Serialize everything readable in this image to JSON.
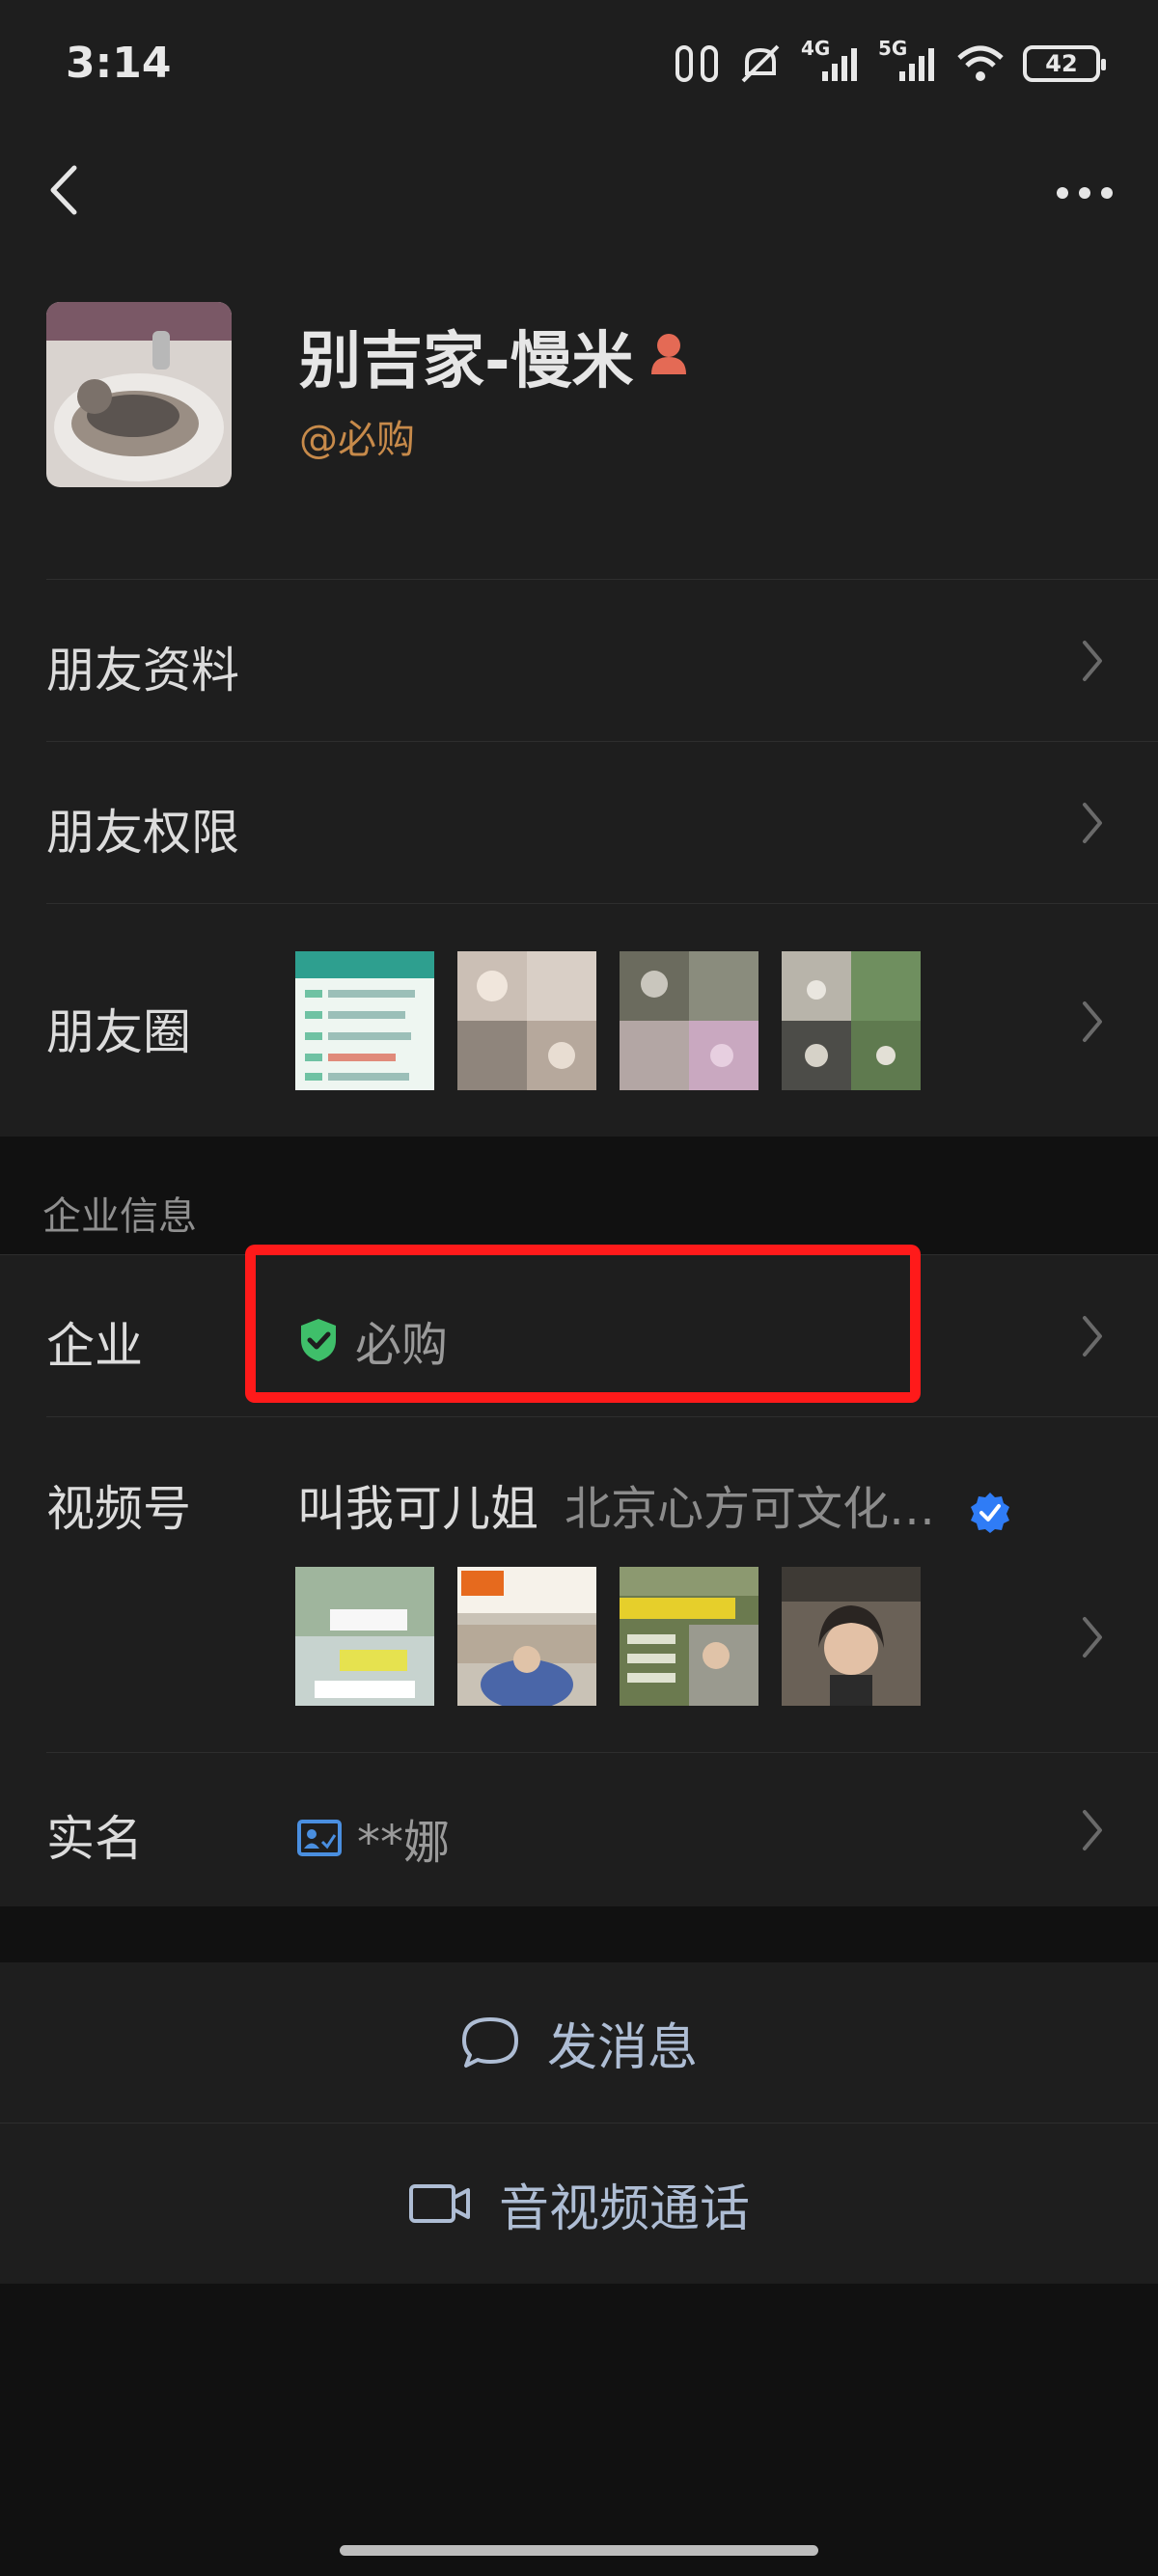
{
  "status_bar": {
    "time": "3:14",
    "network_4g": "4G",
    "network_5g": "5G",
    "battery": "42"
  },
  "profile": {
    "name": "别吉家-慢米",
    "corp_tag": "@必购"
  },
  "rows": {
    "friend_info": "朋友资料",
    "friend_permissions": "朋友权限",
    "moments": "朋友圈"
  },
  "enterprise_section": {
    "title": "企业信息",
    "label": "企业",
    "value": "必购"
  },
  "channels": {
    "label": "视频号",
    "name": "叫我可儿姐",
    "org": "北京心方可文化…"
  },
  "real_name": {
    "label": "实名",
    "value": "**娜"
  },
  "actions": {
    "message": "发消息",
    "call": "音视频通话"
  },
  "colors": {
    "background": "#111111",
    "panel": "#1e1e1e",
    "corp_tag": "#c78a4a",
    "action_text": "#aebdd4",
    "shield": "#3fbf6a",
    "verified": "#2f7cf6",
    "highlight": "#ff1a1a"
  }
}
